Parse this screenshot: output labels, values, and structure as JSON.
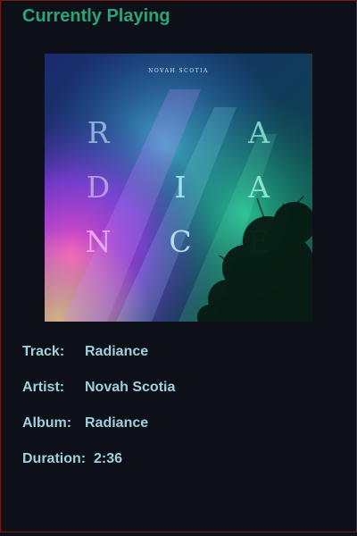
{
  "header": {
    "title": "Currently Playing"
  },
  "album_art": {
    "artist_caption": "NOVAH SCOTIA",
    "letters": [
      "R",
      "A",
      "D",
      "I",
      "A",
      "N",
      "C",
      "E"
    ]
  },
  "track_info": {
    "track_label": "Track:",
    "track_value": "Radiance",
    "artist_label": "Artist:",
    "artist_value": "Novah Scotia",
    "album_label": "Album:",
    "album_value": "Radiance",
    "duration_label": "Duration:",
    "duration_value": "2:36"
  },
  "colors": {
    "background": "#0d1117",
    "title": "#2aa57a",
    "info_text": "#9fd0dc",
    "border": "#7a1b1b"
  }
}
